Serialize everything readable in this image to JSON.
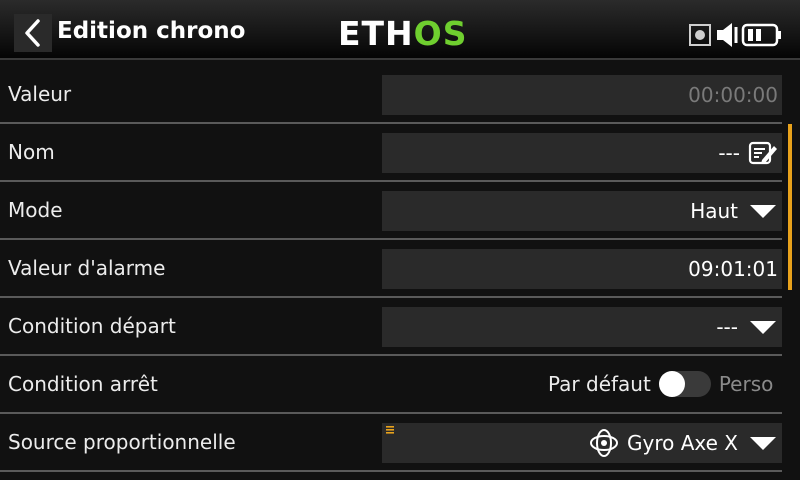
{
  "header": {
    "title": "Edition chrono",
    "logo_part1": "ETH",
    "logo_part2": "OS",
    "logo_accent_color": "#6fcf2f"
  },
  "rows": {
    "valeur": {
      "label": "Valeur",
      "value": "00:00:00"
    },
    "nom": {
      "label": "Nom",
      "value": "---"
    },
    "mode": {
      "label": "Mode",
      "value": "Haut"
    },
    "alarme": {
      "label": "Valeur d'alarme",
      "value": "09:01:01"
    },
    "depart": {
      "label": "Condition départ",
      "value": "---"
    },
    "arret": {
      "label": "Condition arrêt",
      "option_left": "Par défaut",
      "option_right": "Perso",
      "toggle_on": false
    },
    "source": {
      "label": "Source proportionnelle",
      "value": "Gyro Axe X"
    }
  },
  "colors": {
    "scrollbar": "#e8a21c",
    "field_bg": "#2a2a2a"
  }
}
